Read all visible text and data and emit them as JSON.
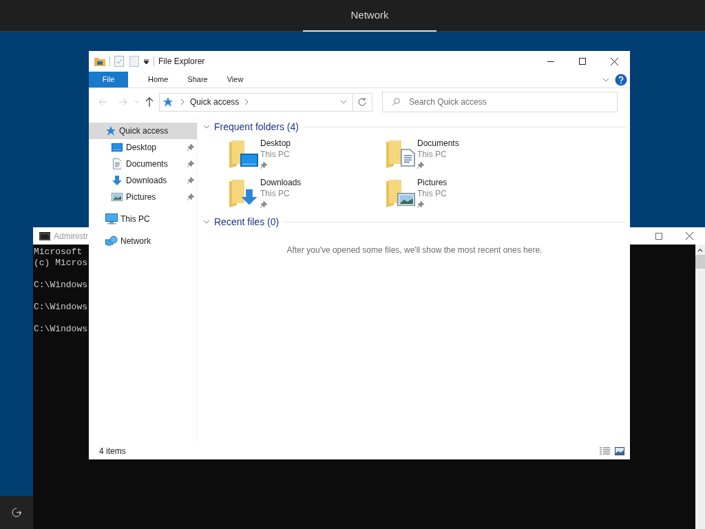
{
  "top_bar": {
    "tabs": [
      {
        "label": "Network",
        "selected": true
      }
    ]
  },
  "console": {
    "title": "Administr",
    "lines": [
      {
        "text": "Microsoft",
        "blank_before": false
      },
      {
        "text": "(c) Micros",
        "blank_before": false
      },
      {
        "text": "C:\\Windows",
        "blank_before": true
      },
      {
        "text": "C:\\Windows",
        "blank_before": true
      },
      {
        "text": "C:\\Windows",
        "blank_before": true
      }
    ]
  },
  "explorer": {
    "title": "File Explorer",
    "ribbon_tabs": [
      {
        "label": "File",
        "kind": "menu"
      },
      {
        "label": "Home",
        "kind": "tab"
      },
      {
        "label": "Share",
        "kind": "tab"
      },
      {
        "label": "View",
        "kind": "tab"
      }
    ],
    "address": "Quick access",
    "search": {
      "placeholder": "Search Quick access"
    },
    "navigation": [
      {
        "label": "Quick access",
        "kind": "star",
        "selected": true,
        "children": [
          {
            "label": "Desktop",
            "kind": "desktop",
            "pinned": true,
            "selected": false
          },
          {
            "label": "Documents",
            "kind": "documents",
            "pinned": true,
            "selected": false
          },
          {
            "label": "Downloads",
            "kind": "downloads",
            "pinned": true,
            "selected": false
          },
          {
            "label": "Pictures",
            "kind": "pictures",
            "pinned": true,
            "selected": false
          }
        ]
      },
      {
        "label": "This PC",
        "kind": "pc",
        "selected": false
      },
      {
        "label": "Network",
        "kind": "network",
        "selected": false
      }
    ],
    "sections": [
      {
        "heading": "Frequent folders (4)",
        "expanded": true,
        "folders": [
          {
            "name": "Desktop",
            "location": "This PC",
            "pinned": true,
            "kind": "desktop"
          },
          {
            "name": "Documents",
            "location": "This PC",
            "pinned": true,
            "kind": "documents"
          },
          {
            "name": "Downloads",
            "location": "This PC",
            "pinned": true,
            "kind": "downloads"
          },
          {
            "name": "Pictures",
            "location": "This PC",
            "pinned": true,
            "kind": "pictures"
          }
        ]
      },
      {
        "heading": "Recent files (0)",
        "expanded": true,
        "empty_message": "After you've opened some files, we'll show the most recent ones here."
      }
    ],
    "status": "4 items"
  }
}
